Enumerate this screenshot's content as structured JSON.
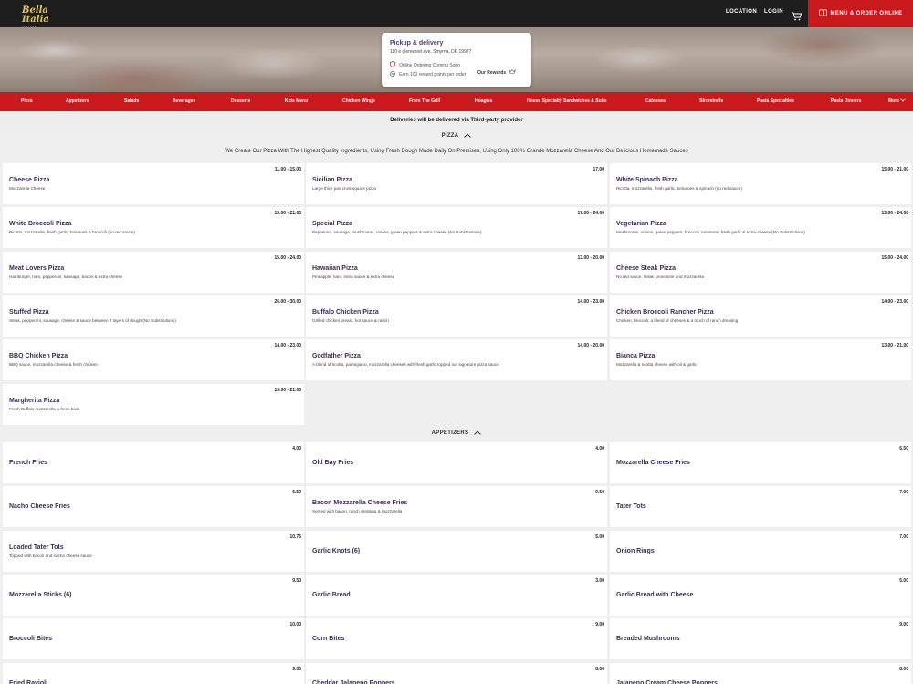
{
  "brand": {
    "logo_text": "Bella Italia",
    "logo_sub": "ITALIAN PIZZERIA"
  },
  "topnav": {
    "location": "LOCATION",
    "login": "LOGIN",
    "order_btn": "MENU & ORDER ONLINE",
    "cart_icon": "cart-icon",
    "menu_icon": "menu-book-icon"
  },
  "pickup": {
    "title": "Pickup & delivery",
    "address": "110 e glenwood ave, Smyrna, DE 19977",
    "ordering_status": "Online Ordering Coming Soon",
    "reward_text": "Earn 100 reward points per order",
    "rewards_link": "Our Rewards"
  },
  "categories": [
    "Pizza",
    "Appetizers",
    "Salads",
    "Beverages",
    "Desserts",
    "Kids Menu",
    "Chicken Wings",
    "From The Grill",
    "Hoagies",
    "House Specialty Sandwiches & Subs",
    "Calzones",
    "Strombolis",
    "Pasta Specialties",
    "Pasta Dinners",
    "More"
  ],
  "notice": "Deliveries will be delivered via Third-party provider",
  "pizza_section": {
    "title": "PIZZA",
    "description": "We Create Our Pizza With The Highest Quality Ingredients, Using Fresh Dough Made Daily On Premises, Using Only 100% Grande Mozzarella Cheese And Our Delicious Homemade Sauces",
    "items": [
      {
        "name": "Cheese Pizza",
        "desc": "Mozzarella Cheese",
        "price": "11.00 - 15.00"
      },
      {
        "name": "Sicilian Pizza",
        "desc": "Large thick pan crust square pizza",
        "price": "17.00"
      },
      {
        "name": "White Spinach Pizza",
        "desc": "Ricotta, mozzarella, fresh garlic, tomatoes & spinach (no red sauce)",
        "price": "15.00 - 21.00"
      },
      {
        "name": "White Broccoli Pizza",
        "desc": "Ricotta, mozzarella, fresh garlic, tomatoes & broccoli (no red sauce)",
        "price": "15.00 - 21.00"
      },
      {
        "name": "Special Pizza",
        "desc": "Pepperoni, sausage, mushrooms, onions, green peppers & extra cheese (No Substitutions)",
        "price": "17.00 - 24.00"
      },
      {
        "name": "Vegetarian Pizza",
        "desc": "Mushrooms, onions, green peppers, broccoli, tomatoes, fresh garlic & extra cheese (No Substitutions)",
        "price": "15.00 - 24.00"
      },
      {
        "name": "Meat Lovers Pizza",
        "desc": "Hamburger, ham, pepperoni, sausage, bacon & extra cheese",
        "price": "15.00 - 24.00"
      },
      {
        "name": "Hawaiian Pizza",
        "desc": "Pineapple, ham, extra sauce & extra cheese",
        "price": "13.00 - 20.00"
      },
      {
        "name": "Cheese Steak Pizza",
        "desc": "No red sauce, steak, provolone and mozzarella",
        "price": "15.00 - 24.00"
      },
      {
        "name": "Stuffed Pizza",
        "desc": "Steak, pepperoni, sausage, cheese & sauce between 2 layers of dough (No Substitutions)",
        "price": "26.00 - 30.00"
      },
      {
        "name": "Buffalo Chicken Pizza",
        "desc": "Grilled chicken breast, hot sauce & ranch",
        "price": "14.00 - 23.00"
      },
      {
        "name": "Chicken Broccoli Rancher Pizza",
        "desc": "Chicken, broccoli, a blend of cheeses & a touch of ranch dressing",
        "price": "14.00 - 23.00"
      },
      {
        "name": "BBQ Chicken Pizza",
        "desc": "BBQ sauce, mozzarella cheese & fresh chicken",
        "price": "14.00 - 23.00"
      },
      {
        "name": "Godfather Pizza",
        "desc": "A blend of ricotta, parmigiano, mozzarella cheeses with fresh garlic topped our signature pizza sauce",
        "price": "14.00 - 20.00"
      },
      {
        "name": "Bianca Pizza",
        "desc": "Mozzarella & ricotta cheese with oil & garlic",
        "price": "13.00 - 21.00"
      },
      {
        "name": "Margherita Pizza",
        "desc": "Fresh Buffalo mozzarella & fresh basil",
        "price": "13.00 - 21.00"
      }
    ]
  },
  "appetizers_section": {
    "title": "APPETIZERS",
    "items": [
      {
        "name": "French Fries",
        "desc": "",
        "price": "4.00"
      },
      {
        "name": "Old Bay Fries",
        "desc": "",
        "price": "4.00"
      },
      {
        "name": "Mozzarella Cheese Fries",
        "desc": "",
        "price": "6.50"
      },
      {
        "name": "Nacho Cheese Fries",
        "desc": "",
        "price": "6.50"
      },
      {
        "name": "Bacon Mozzarella Cheese Fries",
        "desc": "Served with bacon, ranch dressing & mozzarella",
        "price": "9.50"
      },
      {
        "name": "Tater Tots",
        "desc": "",
        "price": "7.00"
      },
      {
        "name": "Loaded Tater Tots",
        "desc": "Topped with bacon and nacho cheese sauce",
        "price": "10.75"
      },
      {
        "name": "Garlic Knots (6)",
        "desc": "",
        "price": "5.00"
      },
      {
        "name": "Onion Rings",
        "desc": "",
        "price": "7.00"
      },
      {
        "name": "Mozzarella Sticks (6)",
        "desc": "",
        "price": "9.50"
      },
      {
        "name": "Garlic Bread",
        "desc": "",
        "price": "3.00"
      },
      {
        "name": "Garlic Bread with Cheese",
        "desc": "",
        "price": "5.00"
      },
      {
        "name": "Broccoli Bites",
        "desc": "",
        "price": "10.00"
      },
      {
        "name": "Corn Bites",
        "desc": "",
        "price": "9.00"
      },
      {
        "name": "Breaded Mushrooms",
        "desc": "",
        "price": "9.00"
      },
      {
        "name": "Fried Ravioli",
        "desc": "",
        "price": "9.00"
      },
      {
        "name": "Cheddar Jalapeno Poppers",
        "desc": "",
        "price": "8.00"
      },
      {
        "name": "Jalapeno Cream Cheese Poppers",
        "desc": "",
        "price": "8.00"
      }
    ]
  },
  "colors": {
    "brand_red": "#c8191d",
    "topbar": "#1e1e1e",
    "item_name": "#3c2a5a"
  }
}
